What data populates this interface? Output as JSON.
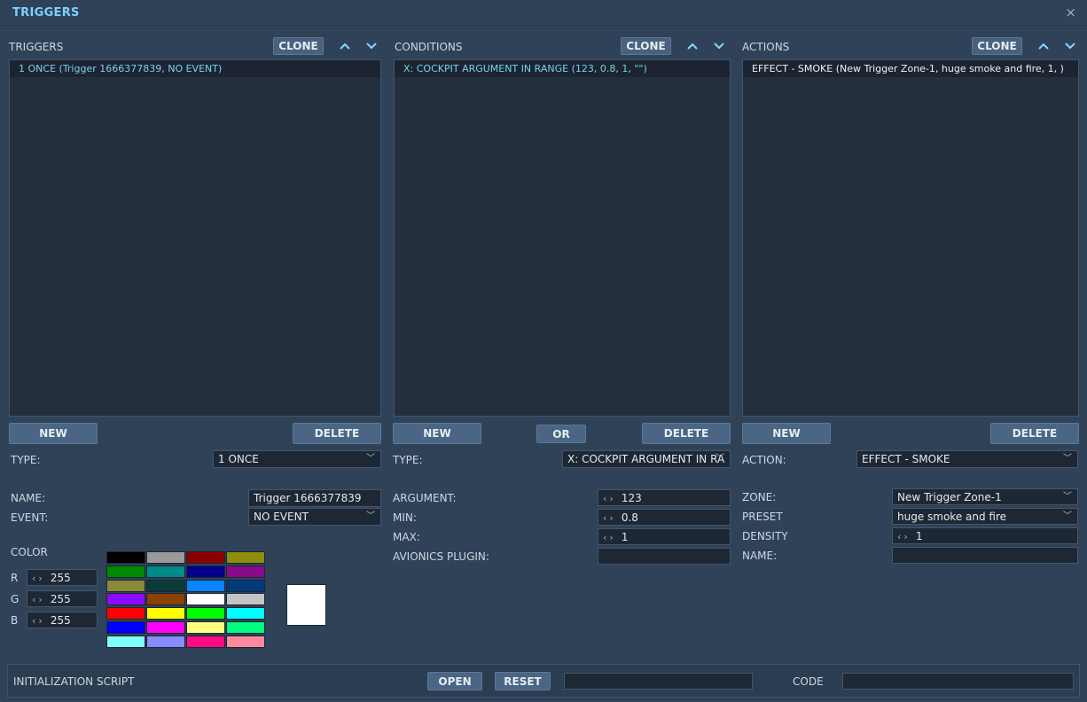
{
  "window": {
    "title": "TRIGGERS",
    "close_symbol": "×"
  },
  "triggers": {
    "header": "TRIGGERS",
    "clone_label": "CLONE",
    "items": [
      "1 ONCE (Trigger 1666377839, NO EVENT)"
    ],
    "new_label": "NEW",
    "delete_label": "DELETE",
    "type_label": "TYPE:",
    "type_value": "1 ONCE",
    "name_label": "NAME:",
    "name_value": "Trigger 1666377839",
    "event_label": "EVENT:",
    "event_value": "NO EVENT",
    "color_label": "COLOR",
    "r_label": "R",
    "r_value": "255",
    "g_label": "G",
    "g_value": "255",
    "b_label": "B",
    "b_value": "255",
    "palette": [
      "#000000",
      "#9a9a9a",
      "#8b0000",
      "#8e8e0a",
      "#008a00",
      "#008a8a",
      "#00008b",
      "#8b0a8b",
      "#8a8a3a",
      "#0a3a3a",
      "#0a84ff",
      "#003a7a",
      "#8a0aff",
      "#8b4200",
      "#ffffff",
      "#c4c4c4",
      "#ff0000",
      "#ffff00",
      "#00ff00",
      "#00ffff",
      "#0000ff",
      "#ff00ff",
      "#ffff80",
      "#00ff80",
      "#80ffff",
      "#8a8aff",
      "#ff0a80",
      "#ff8aa0"
    ]
  },
  "conditions": {
    "header": "CONDITIONS",
    "clone_label": "CLONE",
    "items": [
      "X: COCKPIT ARGUMENT IN RANGE (123, 0.8, 1, \"\")"
    ],
    "new_label": "NEW",
    "or_label": "OR",
    "delete_label": "DELETE",
    "type_label": "TYPE:",
    "type_value": "X: COCKPIT ARGUMENT IN RA",
    "argument_label": "ARGUMENT:",
    "argument_value": "123",
    "min_label": "MIN:",
    "min_value": "0.8",
    "max_label": "MAX:",
    "max_value": "1",
    "avionics_label": "AVIONICS PLUGIN:",
    "avionics_value": ""
  },
  "actions": {
    "header": "ACTIONS",
    "clone_label": "CLONE",
    "items": [
      "EFFECT - SMOKE (New Trigger Zone-1, huge smoke and fire, 1, )"
    ],
    "new_label": "NEW",
    "delete_label": "DELETE",
    "action_label": "ACTION:",
    "action_value": "EFFECT - SMOKE",
    "zone_label": "ZONE:",
    "zone_value": "New Trigger Zone-1",
    "preset_label": "PRESET",
    "preset_value": "huge smoke and fire",
    "density_label": "DENSITY",
    "density_value": "1",
    "name_label": "NAME:",
    "name_value": ""
  },
  "bottom": {
    "init_label": "INITIALIZATION SCRIPT",
    "open_label": "OPEN",
    "reset_label": "RESET",
    "script_value": "",
    "code_label": "CODE",
    "code_value": ""
  },
  "icons": {
    "spin_left": "‹",
    "spin_right": "›",
    "dropdown": "﹀"
  }
}
